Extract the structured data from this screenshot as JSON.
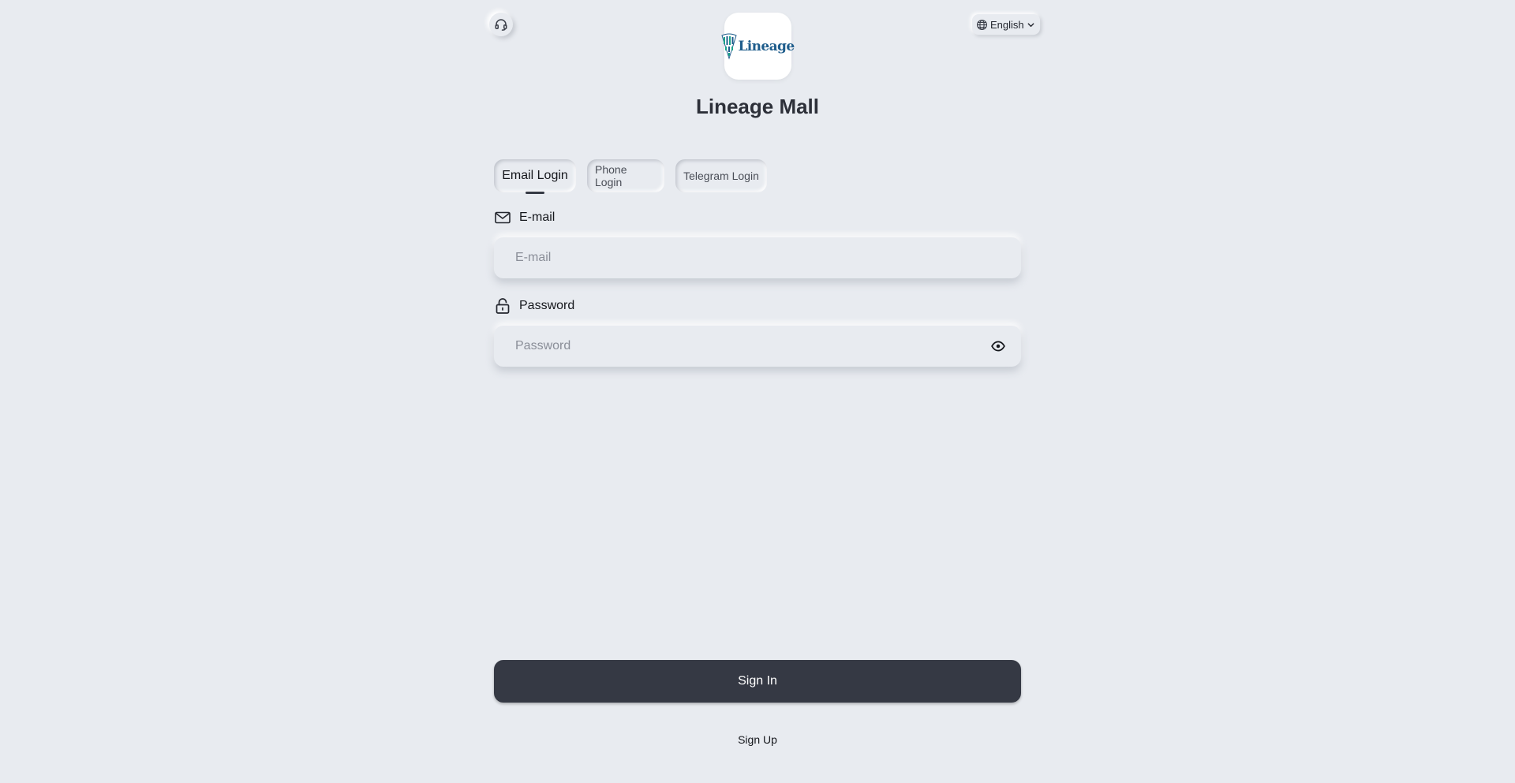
{
  "header": {
    "support_icon": "headset-icon",
    "language": {
      "label": "English",
      "icon": "globe-icon",
      "chevron": "chevron-down-icon"
    }
  },
  "brand": {
    "logo_text": "Lineage",
    "app_title": "Lineage Mall"
  },
  "tabs": [
    {
      "label": "Email Login",
      "active": true
    },
    {
      "label": "Phone Login",
      "active": false
    },
    {
      "label": "Telegram Login",
      "active": false
    }
  ],
  "form": {
    "email": {
      "label": "E-mail",
      "icon": "mail-icon",
      "placeholder": "E-mail",
      "value": ""
    },
    "password": {
      "label": "Password",
      "icon": "unlock-icon",
      "placeholder": "Password",
      "value": "",
      "toggle_icon": "eye-icon"
    }
  },
  "actions": {
    "sign_in": "Sign In",
    "sign_up": "Sign Up"
  },
  "colors": {
    "background": "#e8ebf0",
    "primary_button": "#353944",
    "logo_blue": "#1f5d8c",
    "logo_teal": "#1aa38a"
  }
}
